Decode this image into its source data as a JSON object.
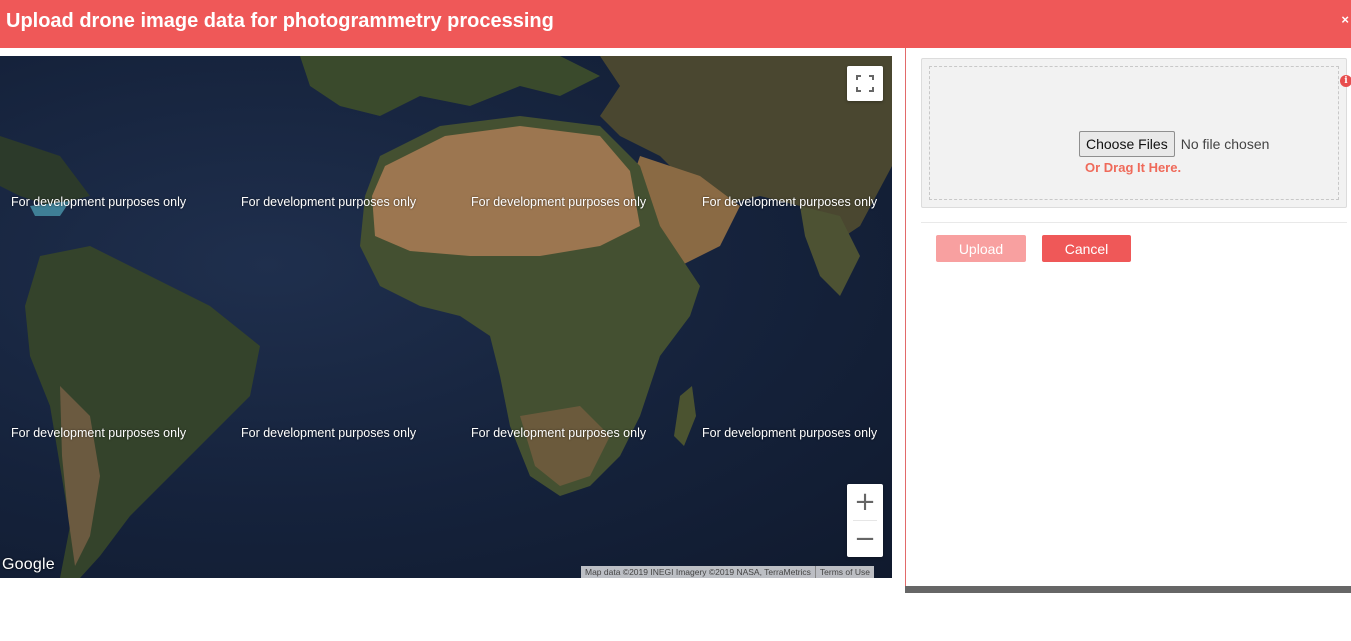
{
  "header": {
    "title": "Upload drone image data for photogrammetry processing",
    "close_label": "×",
    "color": "#ef5858"
  },
  "map": {
    "watermark": "For development purposes only",
    "google_label": "Google",
    "attribution": "Map data ©2019 INEGI Imagery ©2019 NASA, TerraMetrics",
    "terms": "Terms of Use",
    "zoom_in": "+",
    "zoom_out": "−",
    "fullscreen_icon": "fullscreen-icon"
  },
  "upload": {
    "choose_label": "Choose Files",
    "file_status": "No file chosen",
    "drag_hint": "Or Drag It Here.",
    "info_icon": "i",
    "upload_label": "Upload",
    "cancel_label": "Cancel"
  }
}
